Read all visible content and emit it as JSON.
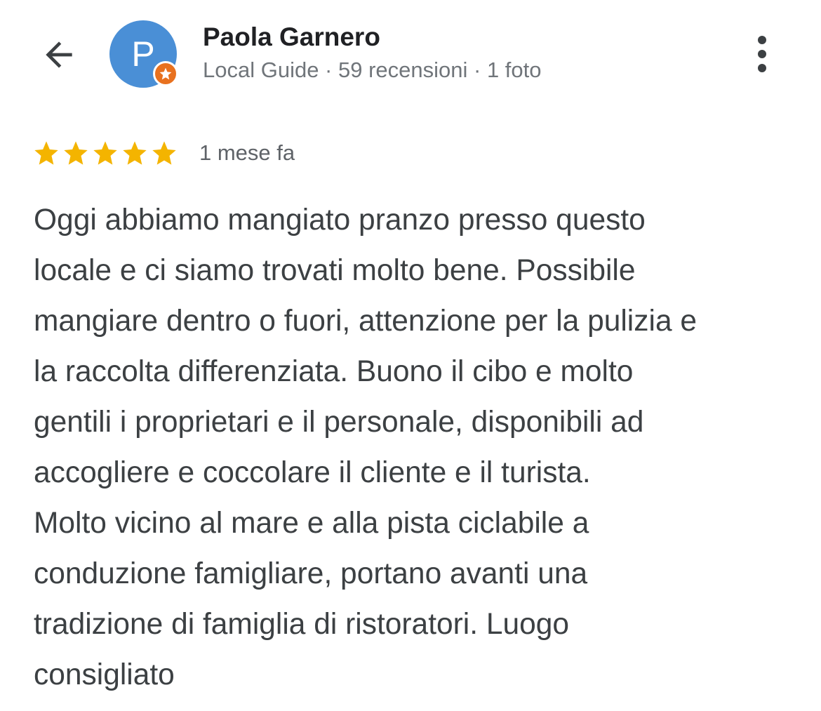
{
  "header": {
    "back_icon": "arrow-left-icon",
    "avatar_initial": "P",
    "badge_icon": "local-guide-star-icon",
    "user_name": "Paola Garnero",
    "user_meta": "Local Guide · 59 recensioni · 1 foto",
    "more_icon": "more-vertical-icon"
  },
  "colors": {
    "avatar_bg": "#4a8fd6",
    "badge_bg": "#e8711f",
    "star": "#f4b400",
    "text": "#3c4043",
    "meta": "#70757a"
  },
  "review": {
    "rating": 5,
    "max_rating": 5,
    "date": "1 mese fa",
    "text": "Oggi abbiamo mangiato pranzo presso questo\nlocale e ci siamo trovati molto bene. Possibile\nmangiare dentro o fuori, attenzione per la pulizia e\nla raccolta differenziata. Buono il cibo e molto\ngentili i proprietari e il personale, disponibili ad\naccogliere e coccolare il cliente e il turista.\nMolto vicino al mare e alla pista ciclabile a\nconduzione famigliare, portano avanti una\ntradizione di famiglia di ristoratori. Luogo\nconsigliato"
  }
}
